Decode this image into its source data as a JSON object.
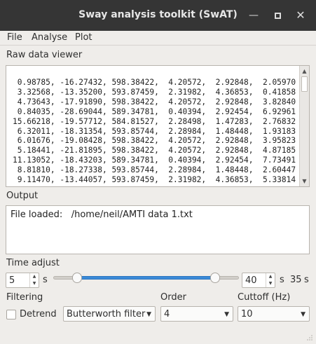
{
  "window": {
    "title": "Sway analysis toolkit (SwAT)",
    "minimize_icon": "minimize-icon",
    "maximize_icon": "maximize-icon",
    "close_icon": "close-icon"
  },
  "menu": {
    "file": "File",
    "analyse": "Analyse",
    "plot": "Plot"
  },
  "raw_viewer": {
    "label": "Raw data viewer",
    "lines": [
      " 0.98785, -16.27432, 598.38422,  4.20572,  2.92848,  2.05970",
      " 3.32568, -13.35200, 593.87459,  2.31982,  4.36853,  0.41858",
      " 4.73643, -17.91890, 598.38422,  4.20572,  2.92848,  3.82840",
      " 0.84035, -28.69044, 589.34781,  0.40394,  2.92454,  6.92961",
      "15.66218, -19.57712, 584.81527,  2.28498,  1.47283,  2.76832",
      " 6.32011, -18.31354, 593.85744,  2.28984,  1.48448,  1.93183",
      " 6.01676, -19.08428, 598.38422,  4.20572,  2.92848,  3.95823",
      " 5.18441, -21.81895, 598.38422,  4.20572,  2.92848,  4.87185",
      "11.13052, -18.43203, 589.34781,  0.40394,  2.92454,  7.73491",
      " 8.81810, -18.27338, 593.85744,  2.28984,  1.48448,  2.60447",
      " 9.11470, -13.44057, 593.87459,  2.31982,  4.36853,  5.33814"
    ]
  },
  "output": {
    "label": "Output",
    "text": "File loaded:   /home/neil/AMTI data 1.txt"
  },
  "time_adjust": {
    "label": "Time adjust",
    "start_value": "5",
    "start_unit": "s",
    "end_value": "40",
    "end_unit": "s",
    "duration_value": "35",
    "duration_unit": "s",
    "range_start_fraction": 0.13,
    "range_end_fraction": 0.87
  },
  "filtering": {
    "label": "Filtering",
    "detrend_label": "Detrend",
    "detrend_checked": false,
    "filter_type": "Butterworth filter",
    "order_label": "Order",
    "order_value": "4",
    "cutoff_label": "Cuttoff (Hz)",
    "cutoff_value": "10"
  },
  "colors": {
    "titlebar": "#353535",
    "background": "#efedea",
    "slider_fill": "#3a8ad8"
  }
}
